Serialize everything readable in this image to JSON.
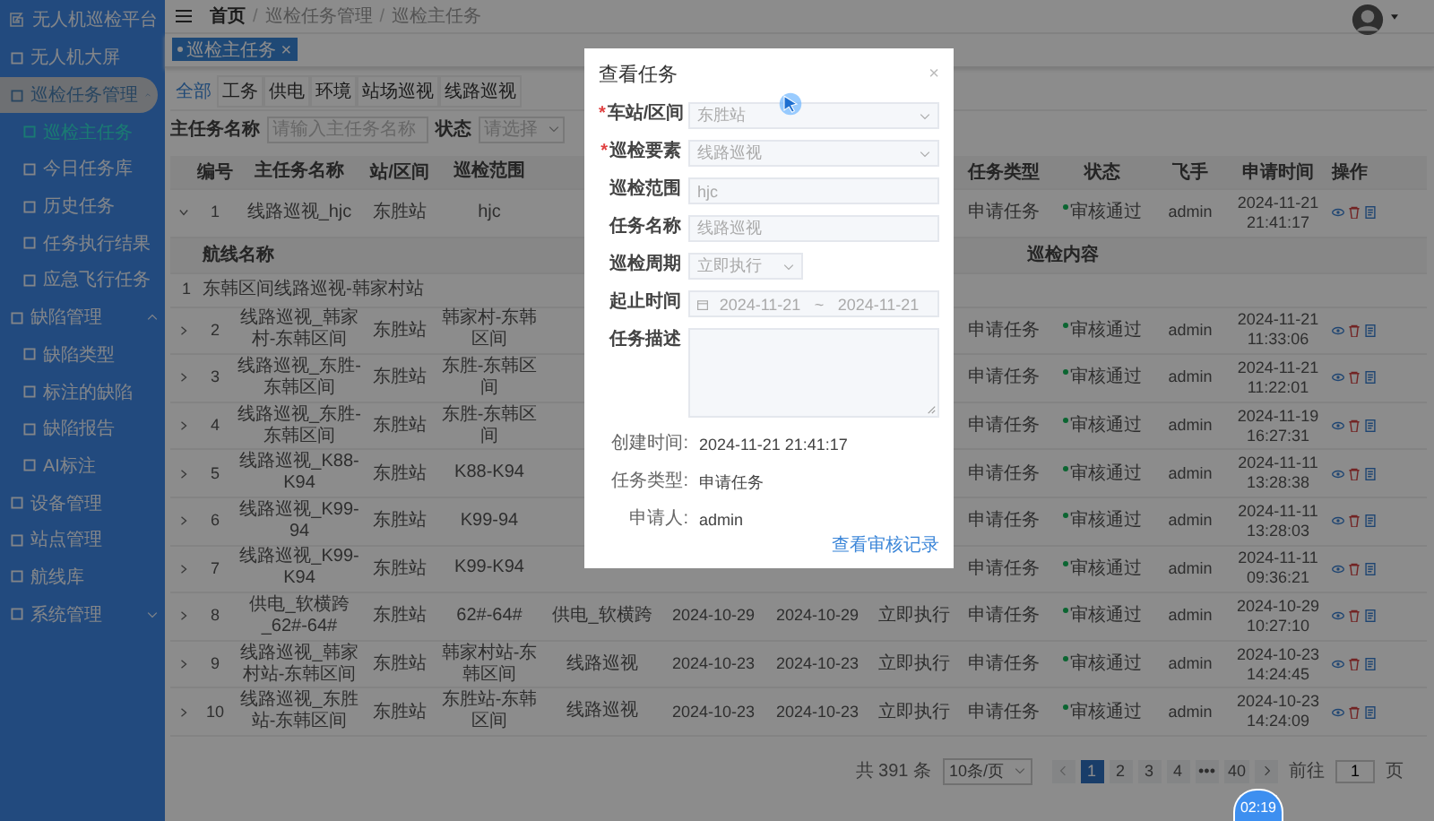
{
  "sidebar": {
    "title": "无人机巡检平台",
    "items": [
      {
        "label": "无人机大屏",
        "selected": false
      },
      {
        "label": "巡检任务管理",
        "expanded": true,
        "hovered": true,
        "selected": false,
        "children": [
          {
            "label": "巡检主任务",
            "selected": true
          },
          {
            "label": "今日任务库",
            "selected": false
          },
          {
            "label": "历史任务",
            "selected": false
          },
          {
            "label": "任务执行结果",
            "selected": false
          },
          {
            "label": "应急飞行任务",
            "selected": false
          }
        ]
      },
      {
        "label": "缺陷管理",
        "expanded": true,
        "hovered": false,
        "selected": false,
        "children": [
          {
            "label": "缺陷类型",
            "selected": false
          },
          {
            "label": "标注的缺陷",
            "selected": false
          },
          {
            "label": "缺陷报告",
            "selected": false
          },
          {
            "label": "AI标注",
            "selected": false
          }
        ]
      },
      {
        "label": "设备管理",
        "selected": false
      },
      {
        "label": "站点管理",
        "selected": false
      },
      {
        "label": "航线库",
        "selected": false
      },
      {
        "label": "系统管理",
        "expanded": false,
        "hovered": false,
        "selected": false
      }
    ]
  },
  "breadcrumb": [
    "首页",
    "巡检任务管理",
    "巡检主任务"
  ],
  "breadcrumb_separator": "/",
  "open_tab": {
    "label": "巡检主任务",
    "close": "×"
  },
  "tabs": [
    {
      "label": "全部",
      "selected": true
    },
    {
      "label": "工务",
      "selected": false
    },
    {
      "label": "供电",
      "selected": false
    },
    {
      "label": "环境",
      "selected": false
    },
    {
      "label": "站场巡视",
      "selected": false
    },
    {
      "label": "线路巡视",
      "selected": false
    }
  ],
  "filters": [
    {
      "label": "主任务名称",
      "placeholder": "请输入主任务名称",
      "kind": "input"
    },
    {
      "label": "状态",
      "placeholder": "请选择",
      "kind": "select"
    }
  ],
  "table": {
    "columns": {
      "no": "编号",
      "name": "主任务名称",
      "station": "站/区间",
      "range": "巡检范围",
      "type": "任务类型",
      "status": "状态",
      "pilot": "飞手",
      "time": "申请时间",
      "ops": "操作"
    },
    "rows": [
      {
        "expanded": true,
        "no": "1",
        "name": "线路巡视_hjc",
        "station": "东胜站",
        "range": "hjc",
        "type": "申请任务",
        "status": "审核通过",
        "pilot": "admin",
        "time": "2024-11-21 21:41:17",
        "sub": {
          "columns": [
            "",
            "航线名称",
            "巡检内容"
          ],
          "rows": [
            [
              "1",
              "东韩区间线路巡视-韩家村站"
            ]
          ]
        }
      },
      {
        "expanded": false,
        "no": "2",
        "name": "线路巡视_韩家村-东韩区间",
        "station": "东胜站",
        "range": "韩家村-东韩区间",
        "type": "申请任务",
        "status": "审核通过",
        "pilot": "admin",
        "time": "2024-11-21 11:33:06"
      },
      {
        "expanded": false,
        "no": "3",
        "name": "线路巡视_东胜-东韩区间",
        "station": "东胜站",
        "range": "东胜-东韩区间",
        "type": "申请任务",
        "status": "审核通过",
        "pilot": "admin",
        "time": "2024-11-21 11:22:01"
      },
      {
        "expanded": false,
        "no": "4",
        "name": "线路巡视_东胜-东韩区间",
        "station": "东胜站",
        "range": "东胜-东韩区间",
        "type": "申请任务",
        "status": "审核通过",
        "pilot": "admin",
        "time": "2024-11-19 16:27:31"
      },
      {
        "expanded": false,
        "no": "5",
        "name": "线路巡视_K88-K94",
        "station": "东胜站",
        "range": "K88-K94",
        "type": "申请任务",
        "status": "审核通过",
        "pilot": "admin",
        "time": "2024-11-11 13:28:38"
      },
      {
        "expanded": false,
        "no": "6",
        "name": "线路巡视_K99-94",
        "station": "东胜站",
        "range": "K99-94",
        "type": "申请任务",
        "status": "审核通过",
        "pilot": "admin",
        "time": "2024-11-11 13:28:03"
      },
      {
        "expanded": false,
        "no": "7",
        "name": "线路巡视_K99-K94",
        "station": "东胜站",
        "range": "K99-K94",
        "type": "申请任务",
        "status": "审核通过",
        "pilot": "admin",
        "time": "2024-11-11 09:36:21"
      },
      {
        "expanded": false,
        "no": "8",
        "name": "供电_软横跨_62#-64#",
        "station": "东胜站",
        "range": "62#-64#",
        "column_6": "供电_软横跨",
        "column_7": "2024-10-29",
        "column_8": "2024-10-29",
        "column_9": "立即执行",
        "type": "申请任务",
        "status": "审核通过",
        "pilot": "admin",
        "time": "2024-10-29 10:27:10"
      },
      {
        "expanded": false,
        "no": "9",
        "name": "线路巡视_韩家村站-东韩区间",
        "station": "东胜站",
        "range": "韩家村站-东韩区间",
        "column_6": "线路巡视",
        "column_7": "2024-10-23",
        "column_8": "2024-10-23",
        "column_9": "立即执行",
        "type": "申请任务",
        "status": "审核通过",
        "pilot": "admin",
        "time": "2024-10-23 14:24:45"
      },
      {
        "expanded": false,
        "no": "10",
        "name": "线路巡视_东胜站-东韩区间",
        "station": "东胜站",
        "range": "东胜站-东韩区间",
        "column_6": "线路巡视",
        "column_7": "2024-10-23",
        "column_8": "2024-10-23",
        "column_9": "立即执行",
        "type": "申请任务",
        "status": "审核通过",
        "pilot": "admin",
        "time": "2024-10-23 14:24:09"
      }
    ]
  },
  "pagination": {
    "total": "共 391 条",
    "page_size": "10条/页",
    "pages": [
      {
        "label": "1",
        "selected": true
      },
      {
        "label": "2",
        "selected": false
      },
      {
        "label": "3",
        "selected": false
      },
      {
        "label": "4",
        "selected": false
      },
      {
        "label": "•••",
        "selected": false
      },
      {
        "label": "40",
        "selected": false
      }
    ],
    "goto_label": "前往",
    "goto_value": "1",
    "goto_suffix": "页"
  },
  "dialog": {
    "title": "查看任务",
    "close": "×",
    "required_mark": "*",
    "fields": [
      {
        "label": "车站/区间",
        "required": true,
        "kind": "select",
        "value": "东胜站"
      },
      {
        "label": "巡检要素",
        "required": true,
        "kind": "select",
        "value": "线路巡视"
      },
      {
        "label": "巡检范围",
        "required": false,
        "kind": "input",
        "value": "hjc"
      },
      {
        "label": "任务名称",
        "required": false,
        "kind": "input",
        "value": "线路巡视"
      },
      {
        "label": "巡检周期",
        "required": false,
        "kind": "small-select",
        "value": "立即执行"
      },
      {
        "label": "起止时间",
        "required": false,
        "kind": "range",
        "value": "2024-11-21",
        "value_end": "2024-11-21",
        "separator": "~"
      },
      {
        "label": "任务描述",
        "required": false,
        "kind": "textarea"
      }
    ],
    "info": [
      {
        "label": "创建时间:",
        "value": "2024-11-21 21:41:17"
      },
      {
        "label": "任务类型:",
        "value": "申请任务"
      },
      {
        "label": "申请人:",
        "value": "admin"
      }
    ],
    "link": "查看审核记录"
  },
  "timer": "02:19"
}
